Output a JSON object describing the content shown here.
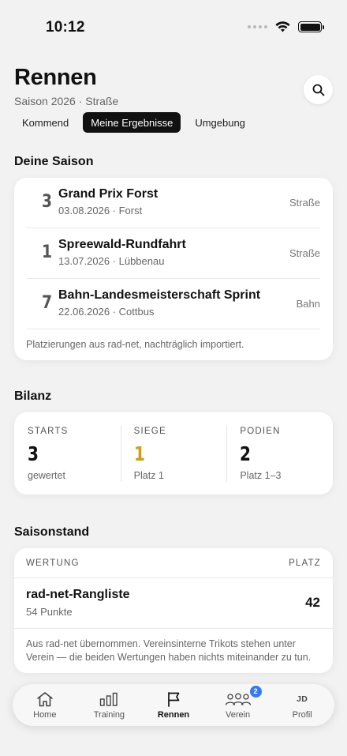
{
  "status_bar": {
    "time": "10:12"
  },
  "header": {
    "title": "Rennen",
    "subtitle": "Saison 2026 · Straße"
  },
  "filters": [
    {
      "label": "Kommend",
      "active": false
    },
    {
      "label": "Meine Ergebnisse",
      "active": true
    },
    {
      "label": "Umgebung",
      "active": false
    }
  ],
  "season": {
    "title": "Deine Saison",
    "results": [
      {
        "rank": "3",
        "name": "Grand Prix Forst",
        "meta": "03.08.2026 · Forst",
        "type": "Straße"
      },
      {
        "rank": "1",
        "name": "Spreewald-Rundfahrt",
        "meta": "13.07.2026 · Lübbenau",
        "type": "Straße"
      },
      {
        "rank": "7",
        "name": "Bahn-Landesmeisterschaft Sprint",
        "meta": "22.06.2026 · Cottbus",
        "type": "Bahn"
      }
    ],
    "footnote": "Platzierungen aus rad-net, nachträglich importiert."
  },
  "bilanz": {
    "title": "Bilanz",
    "stats": [
      {
        "label": "STARTS",
        "value": "3",
        "sub": "gewertet",
        "color": "#111111"
      },
      {
        "label": "SIEGE",
        "value": "1",
        "sub": "Platz 1",
        "color": "#c9a018"
      },
      {
        "label": "PODIEN",
        "value": "2",
        "sub": "Platz 1–3",
        "color": "#111111"
      }
    ]
  },
  "standing": {
    "title": "Saisonstand",
    "col_left": "WERTUNG",
    "col_right": "PLATZ",
    "row": {
      "name": "rad-net-Rangliste",
      "points": "54 Punkte",
      "place": "42"
    },
    "footnote": "Aus rad-net übernommen. Vereinsinterne Trikots stehen unter Verein — die beiden Wertungen haben nichts miteinander zu tun."
  },
  "tabbar": {
    "items": [
      {
        "label": "Home",
        "icon": "home-icon"
      },
      {
        "label": "Training",
        "icon": "bar-chart-icon"
      },
      {
        "label": "Rennen",
        "icon": "flag-icon",
        "active": true
      },
      {
        "label": "Verein",
        "icon": "people-icon",
        "badge": "2"
      },
      {
        "label": "Profil",
        "icon": "avatar",
        "initials": "JD"
      }
    ]
  }
}
